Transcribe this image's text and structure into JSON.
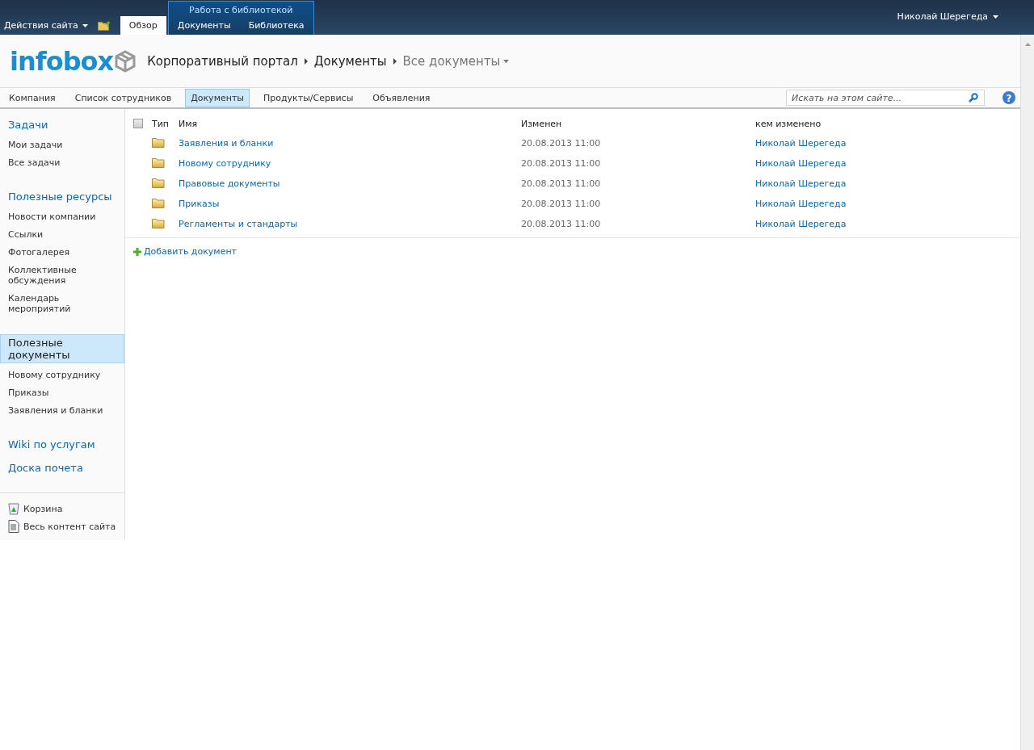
{
  "ribbon": {
    "site_actions": "Действия сайта",
    "tabs": [
      {
        "label": "Обзор",
        "selected": true
      }
    ],
    "context_group": {
      "title": "Работа с библиотекой",
      "tabs": [
        {
          "label": "Документы",
          "selected": false
        },
        {
          "label": "Библиотека",
          "selected": false
        }
      ]
    },
    "user": "Николай Шерегеда"
  },
  "header": {
    "logo": "infobox",
    "breadcrumb": [
      "Корпоративный портал",
      "Документы"
    ],
    "view": "Все документы"
  },
  "top_nav": [
    {
      "label": "Компания",
      "selected": false
    },
    {
      "label": "Список сотрудников",
      "selected": false
    },
    {
      "label": "Документы",
      "selected": true
    },
    {
      "label": "Продукты/Сервисы",
      "selected": false
    },
    {
      "label": "Объявления",
      "selected": false
    }
  ],
  "search": {
    "placeholder": "Искать на этом сайте..."
  },
  "help": "?",
  "sidebar": {
    "groups": [
      {
        "heading": "Задачи",
        "selected": false,
        "items": [
          "Мои задачи",
          "Все задачи"
        ]
      },
      {
        "heading": "Полезные ресурсы",
        "selected": false,
        "items": [
          "Новости компании",
          "Ссылки",
          "Фотогалерея",
          "Коллективные обсуждения",
          "Календарь мероприятий"
        ]
      },
      {
        "heading": "Полезные документы",
        "selected": true,
        "items": [
          "Новому сотруднику",
          "Приказы",
          "Заявления и бланки"
        ]
      },
      {
        "heading": "Wiki по услугам",
        "selected": false
      },
      {
        "heading": "Доска почета",
        "selected": false
      }
    ],
    "tools": [
      {
        "kind": "recycle",
        "label": "Корзина"
      },
      {
        "kind": "content",
        "label": "Весь контент сайта"
      }
    ]
  },
  "table": {
    "select_all": {
      "checked": false
    },
    "columns": [
      "Тип",
      "Имя",
      "Изменен",
      "кем изменено"
    ],
    "rows": [
      {
        "name": "Заявления и бланки",
        "modified": "20.08.2013 11:00",
        "modified_by": "Николай Шерегеда"
      },
      {
        "name": "Новому сотруднику",
        "modified": "20.08.2013 11:00",
        "modified_by": "Николай Шерегеда"
      },
      {
        "name": "Правовые документы",
        "modified": "20.08.2013 11:00",
        "modified_by": "Николай Шерегеда"
      },
      {
        "name": "Приказы",
        "modified": "20.08.2013 11:00",
        "modified_by": "Николай Шерегеда"
      },
      {
        "name": "Регламенты и стандарты",
        "modified": "20.08.2013 11:00",
        "modified_by": "Николай Шерегеда"
      }
    ]
  },
  "add_document": "Добавить документ"
}
